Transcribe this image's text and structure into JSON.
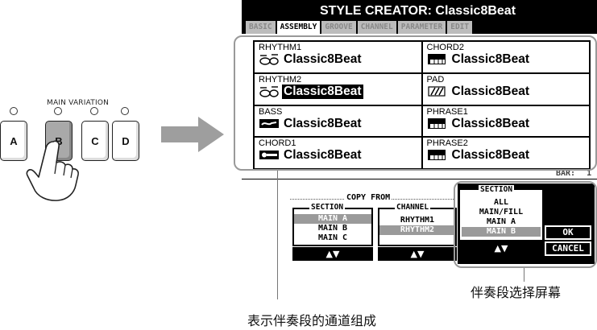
{
  "panel": {
    "label": "MAIN VARIATION",
    "buttons": [
      "A",
      "B",
      "C",
      "D"
    ],
    "active_index": 1
  },
  "screen": {
    "title": "STYLE CREATOR: Classic8Beat",
    "tabs": [
      "BASIC",
      "ASSEMBLY",
      "GROOVE",
      "CHANNEL",
      "PARAMETER",
      "EDIT"
    ],
    "active_tab": "ASSEMBLY",
    "channels": [
      {
        "name": "RHYTHM1",
        "style": "Classic8Beat",
        "icon": "drum-kit-icon"
      },
      {
        "name": "CHORD2",
        "style": "Classic8Beat",
        "icon": "piano-icon"
      },
      {
        "name": "RHYTHM2",
        "style": "Classic8Beat",
        "icon": "drum-kit-icon",
        "selected": true
      },
      {
        "name": "PAD",
        "style": "Classic8Beat",
        "icon": "strings-icon"
      },
      {
        "name": "BASS",
        "style": "Classic8Beat",
        "icon": "bass-icon"
      },
      {
        "name": "PHRASE1",
        "style": "Classic8Beat",
        "icon": "piano-icon"
      },
      {
        "name": "CHORD1",
        "style": "Classic8Beat",
        "icon": "guitar-icon"
      },
      {
        "name": "PHRASE2",
        "style": "Classic8Beat",
        "icon": "piano-icon"
      }
    ],
    "bar_label": "BAR:",
    "bar_value": "1",
    "copy_from_label": "COPY FROM",
    "copy_section": {
      "title": "SECTION",
      "items": [
        "MAIN A",
        "MAIN B",
        "MAIN C"
      ],
      "selected": 0
    },
    "copy_channel": {
      "title": "CHANNEL",
      "items": [
        "RHYTHM1",
        "RHYTHM2"
      ],
      "selected": 1
    },
    "target_section": {
      "title": "SECTION",
      "items": [
        "ALL",
        "MAIN/FILL",
        "MAIN A",
        "MAIN B"
      ],
      "selected": 3
    },
    "arrow_glyph": "▲▼",
    "ok_label": "OK",
    "cancel_label": "CANCEL"
  },
  "captions": {
    "section_screen": "伴奏段选择屏幕",
    "channel_composition": "表示伴奏段的通道组成"
  },
  "colors": {
    "screen_black": "#000000",
    "tab_inactive": "#bcbcbc",
    "selected_gray": "#9a9a9a",
    "arrow_gray": "#a0a0a0",
    "callout_gray": "#999999"
  }
}
